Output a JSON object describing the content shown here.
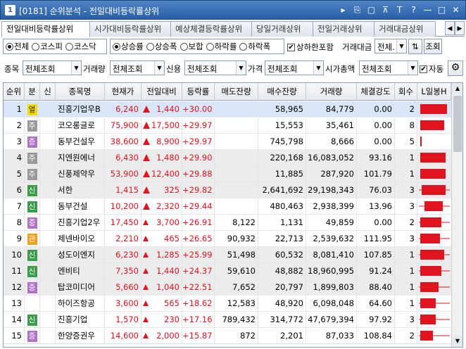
{
  "window": {
    "num": "1",
    "title": "[0181] 순위분석 - 전일대비등락률상위",
    "controls": [
      "▸",
      "⎘",
      "▢",
      "⊼",
      "T",
      "?",
      "—",
      "□",
      "✕"
    ]
  },
  "tabs": [
    {
      "label": "전일대비등락률상위",
      "active": true
    },
    {
      "label": "시가대비등락률상위",
      "active": false
    },
    {
      "label": "예상체결등락률상위",
      "active": false
    },
    {
      "label": "당일거래상위",
      "active": false
    },
    {
      "label": "전일거래상위",
      "active": false
    },
    {
      "label": "거래대금상위",
      "active": false
    }
  ],
  "market_radios": [
    {
      "label": "전체",
      "checked": true
    },
    {
      "label": "코스피",
      "checked": false
    },
    {
      "label": "코스닥",
      "checked": false
    }
  ],
  "type_radios": [
    {
      "label": "상승률",
      "checked": true
    },
    {
      "label": "상승폭",
      "checked": false
    },
    {
      "label": "보합",
      "checked": false
    },
    {
      "label": "하락률",
      "checked": false
    },
    {
      "label": "하락폭",
      "checked": false
    }
  ],
  "limit_checkbox": {
    "label": "상하한포함",
    "checked": true
  },
  "trade_amount": {
    "label": "거래대금",
    "value": "전체."
  },
  "query_button": "조회",
  "filters": {
    "stock": {
      "label": "종목",
      "value": "전체조회"
    },
    "volume": {
      "label": "거래량",
      "value": "전체조회"
    },
    "credit": {
      "label": "신용",
      "value": "전체조회"
    },
    "price": {
      "label": "가격",
      "value": "전체조회"
    },
    "mcap": {
      "label": "시가총액",
      "value": "전체조회"
    },
    "auto": {
      "label": "자동",
      "checked": true
    }
  },
  "columns": [
    "순위",
    "분",
    "신",
    "종목명",
    "현재가",
    "전일대비",
    "등락률",
    "매도잔량",
    "매수잔량",
    "거래량",
    "체결강도",
    "회수",
    "L일봉H"
  ],
  "rows": [
    {
      "rank": "1",
      "cat": "열",
      "cat_color": "#f2d90d",
      "credit": "",
      "name": "진흥기업우B",
      "price": "6,240",
      "change": "1,440",
      "arrow": "up",
      "rate": "+30.00",
      "ask": "",
      "bid": "58,965",
      "volume": "84,779",
      "strength": "0.00",
      "count": "2",
      "spark": {
        "body": 0.95,
        "left": 0.0,
        "right": 0.0
      }
    },
    {
      "rank": "2",
      "cat": "주",
      "cat_color": "#9a9a9a",
      "credit": "",
      "name": "코오롱글로",
      "price": "75,900",
      "change": "17,500",
      "arrow": "up",
      "rate": "+29.97",
      "ask": "",
      "bid": "15,553",
      "volume": "35,461",
      "strength": "0.00",
      "count": "8",
      "spark": {
        "body": 0.85,
        "left": 0.0,
        "right": 0.0
      }
    },
    {
      "rank": "3",
      "cat": "증",
      "cat_color": "#b072c8",
      "credit": "",
      "name": "동부건설우",
      "price": "38,600",
      "change": "8,900",
      "arrow": "up",
      "rate": "+29.97",
      "ask": "",
      "bid": "745,798",
      "volume": "8,666",
      "strength": "0.00",
      "count": "5",
      "spark": {
        "body": 0.04,
        "left": 0.0,
        "right": 0.0
      }
    },
    {
      "rank": "4",
      "cat": "주",
      "cat_color": "#9a9a9a",
      "credit": "",
      "name": "지엔원에너",
      "price": "6,430",
      "change": "1,480",
      "arrow": "up",
      "rate": "+29.90",
      "ask": "",
      "bid": "220,168",
      "volume": "16,083,052",
      "strength": "93.16",
      "count": "1",
      "spark": {
        "body": 0.9,
        "left": 0.0,
        "right": 0.0
      }
    },
    {
      "rank": "5",
      "cat": "주",
      "cat_color": "#9a9a9a",
      "credit": "",
      "name": "신풍제약우",
      "price": "53,900",
      "change": "12,400",
      "arrow": "up",
      "rate": "+29.88",
      "ask": "",
      "bid": "11,885",
      "volume": "287,920",
      "strength": "101.79",
      "count": "1",
      "spark": {
        "body": 0.9,
        "left": 0.0,
        "right": 0.0
      }
    },
    {
      "rank": "6",
      "cat": "신",
      "cat_color": "#3a9b4a",
      "credit": "",
      "name": "서한",
      "price": "1,415",
      "change": "325",
      "arrow": "up",
      "rate": "+29.82",
      "ask": "",
      "bid": "2,641,692",
      "volume": "29,198,343",
      "strength": "76.03",
      "count": "3",
      "spark": {
        "body": 0.85,
        "left": 0.05,
        "right": 0.0
      }
    },
    {
      "rank": "7",
      "cat": "신",
      "cat_color": "#3a9b4a",
      "credit": "",
      "name": "동부건설",
      "price": "10,200",
      "change": "2,320",
      "arrow": "up",
      "rate": "+29.44",
      "ask": "",
      "bid": "480,463",
      "volume": "2,938,399",
      "strength": "13.96",
      "count": "3",
      "spark": {
        "body": 0.65,
        "left": 0.15,
        "right": 0.1
      }
    },
    {
      "rank": "8",
      "cat": "증",
      "cat_color": "#b072c8",
      "credit": "",
      "name": "진흥기업2우",
      "price": "17,450",
      "change": "3,700",
      "arrow": "up-small",
      "rate": "+26.91",
      "ask": "8,122",
      "bid": "1,131",
      "volume": "49,859",
      "strength": "0.00",
      "count": "2",
      "spark": {
        "body": 0.75,
        "left": 0.0,
        "right": 0.15
      }
    },
    {
      "rank": "9",
      "cat": "관",
      "cat_color": "#f0a020",
      "credit": "",
      "name": "제넨바이오",
      "price": "2,210",
      "change": "465",
      "arrow": "up-small",
      "rate": "+26.65",
      "ask": "90,932",
      "bid": "22,713",
      "volume": "2,539,632",
      "strength": "111.95",
      "count": "3",
      "spark": {
        "body": 0.7,
        "left": 0.0,
        "right": 0.2
      }
    },
    {
      "rank": "10",
      "cat": "신",
      "cat_color": "#3a9b4a",
      "credit": "",
      "name": "성도이엔지",
      "price": "6,230",
      "change": "1,285",
      "arrow": "up-small",
      "rate": "+25.99",
      "ask": "51,498",
      "bid": "60,532",
      "volume": "8,081,410",
      "strength": "107.85",
      "count": "1",
      "spark": {
        "body": 0.85,
        "left": 0.0,
        "right": 0.05
      }
    },
    {
      "rank": "11",
      "cat": "신",
      "cat_color": "#3a9b4a",
      "credit": "",
      "name": "엔비티",
      "price": "7,350",
      "change": "1,440",
      "arrow": "up-small",
      "rate": "+24.37",
      "ask": "59,610",
      "bid": "48,882",
      "volume": "18,960,995",
      "strength": "91.24",
      "count": "1",
      "spark": {
        "body": 0.75,
        "left": 0.0,
        "right": 0.1
      }
    },
    {
      "rank": "12",
      "cat": "증",
      "cat_color": "#b072c8",
      "credit": "",
      "name": "탑코미디어",
      "price": "5,660",
      "change": "1,040",
      "arrow": "up-small",
      "rate": "+22.51",
      "ask": "7,652",
      "bid": "20,797",
      "volume": "1,899,803",
      "strength": "88.40",
      "count": "1",
      "spark": {
        "body": 0.65,
        "left": 0.0,
        "right": 0.2
      }
    },
    {
      "rank": "13",
      "cat": "",
      "cat_color": "",
      "credit": "",
      "name": "하이즈항공",
      "price": "3,600",
      "change": "565",
      "arrow": "up-small",
      "rate": "+18.62",
      "ask": "12,583",
      "bid": "48,920",
      "volume": "6,098,048",
      "strength": "64.60",
      "count": "1",
      "spark": {
        "body": 0.55,
        "left": 0.0,
        "right": 0.3
      }
    },
    {
      "rank": "14",
      "cat": "신",
      "cat_color": "#3a9b4a",
      "credit": "",
      "name": "진흥기업",
      "price": "1,570",
      "change": "230",
      "arrow": "up-small",
      "rate": "+17.16",
      "ask": "789,432",
      "bid": "314,772",
      "volume": "47,679,394",
      "strength": "97.92",
      "count": "3",
      "spark": {
        "body": 0.55,
        "left": 0.0,
        "right": 0.3
      }
    },
    {
      "rank": "15",
      "cat": "증",
      "cat_color": "#b072c8",
      "credit": "",
      "name": "한양증권우",
      "price": "14,600",
      "change": "2,000",
      "arrow": "up-small",
      "rate": "+15.87",
      "ask": "872",
      "bid": "2,201",
      "volume": "87,033",
      "strength": "108.84",
      "count": "2",
      "spark": {
        "body": 0.45,
        "left": 0.0,
        "right": 0.4
      }
    }
  ],
  "selected_row": 0,
  "colors": {
    "up": "#e0141e",
    "titlebar": "#2a5fa6",
    "selected": "#d8e6f7",
    "spark": "#e0141e"
  }
}
